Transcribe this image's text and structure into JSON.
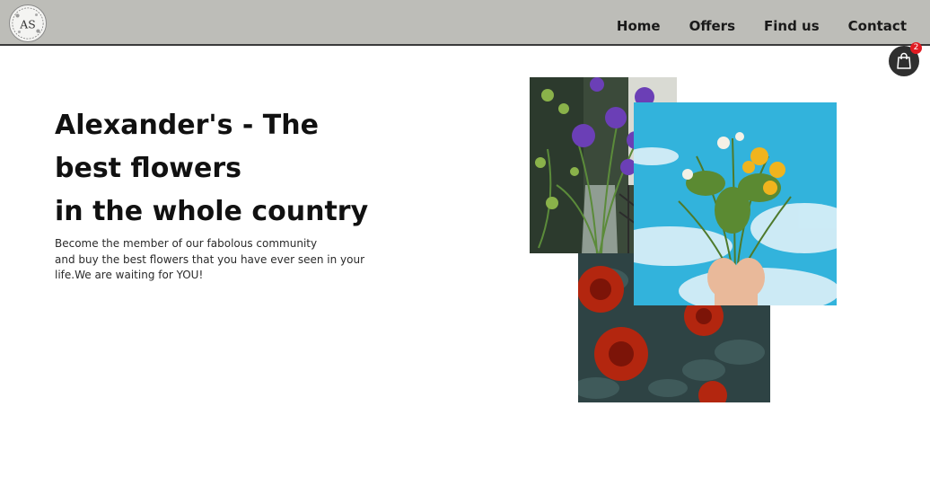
{
  "header": {
    "logo_text": "AS",
    "nav": [
      "Home",
      "Offers",
      "Find us",
      "Contact"
    ]
  },
  "cart": {
    "icon": "shopping-bag-icon",
    "count": "2"
  },
  "hero": {
    "title_lines": [
      "Alexander's - The",
      "best flowers",
      "in the whole country"
    ],
    "text_lines": [
      "Become the member of our fabolous community",
      "and buy the best flowers that you have ever seen in your",
      "life.We are waiting for YOU!"
    ]
  },
  "colors": {
    "navbar_bg": "#bdbdb8",
    "cart_bg": "#2f2f2f",
    "badge_red": "#e11b22",
    "text": "#111111"
  }
}
